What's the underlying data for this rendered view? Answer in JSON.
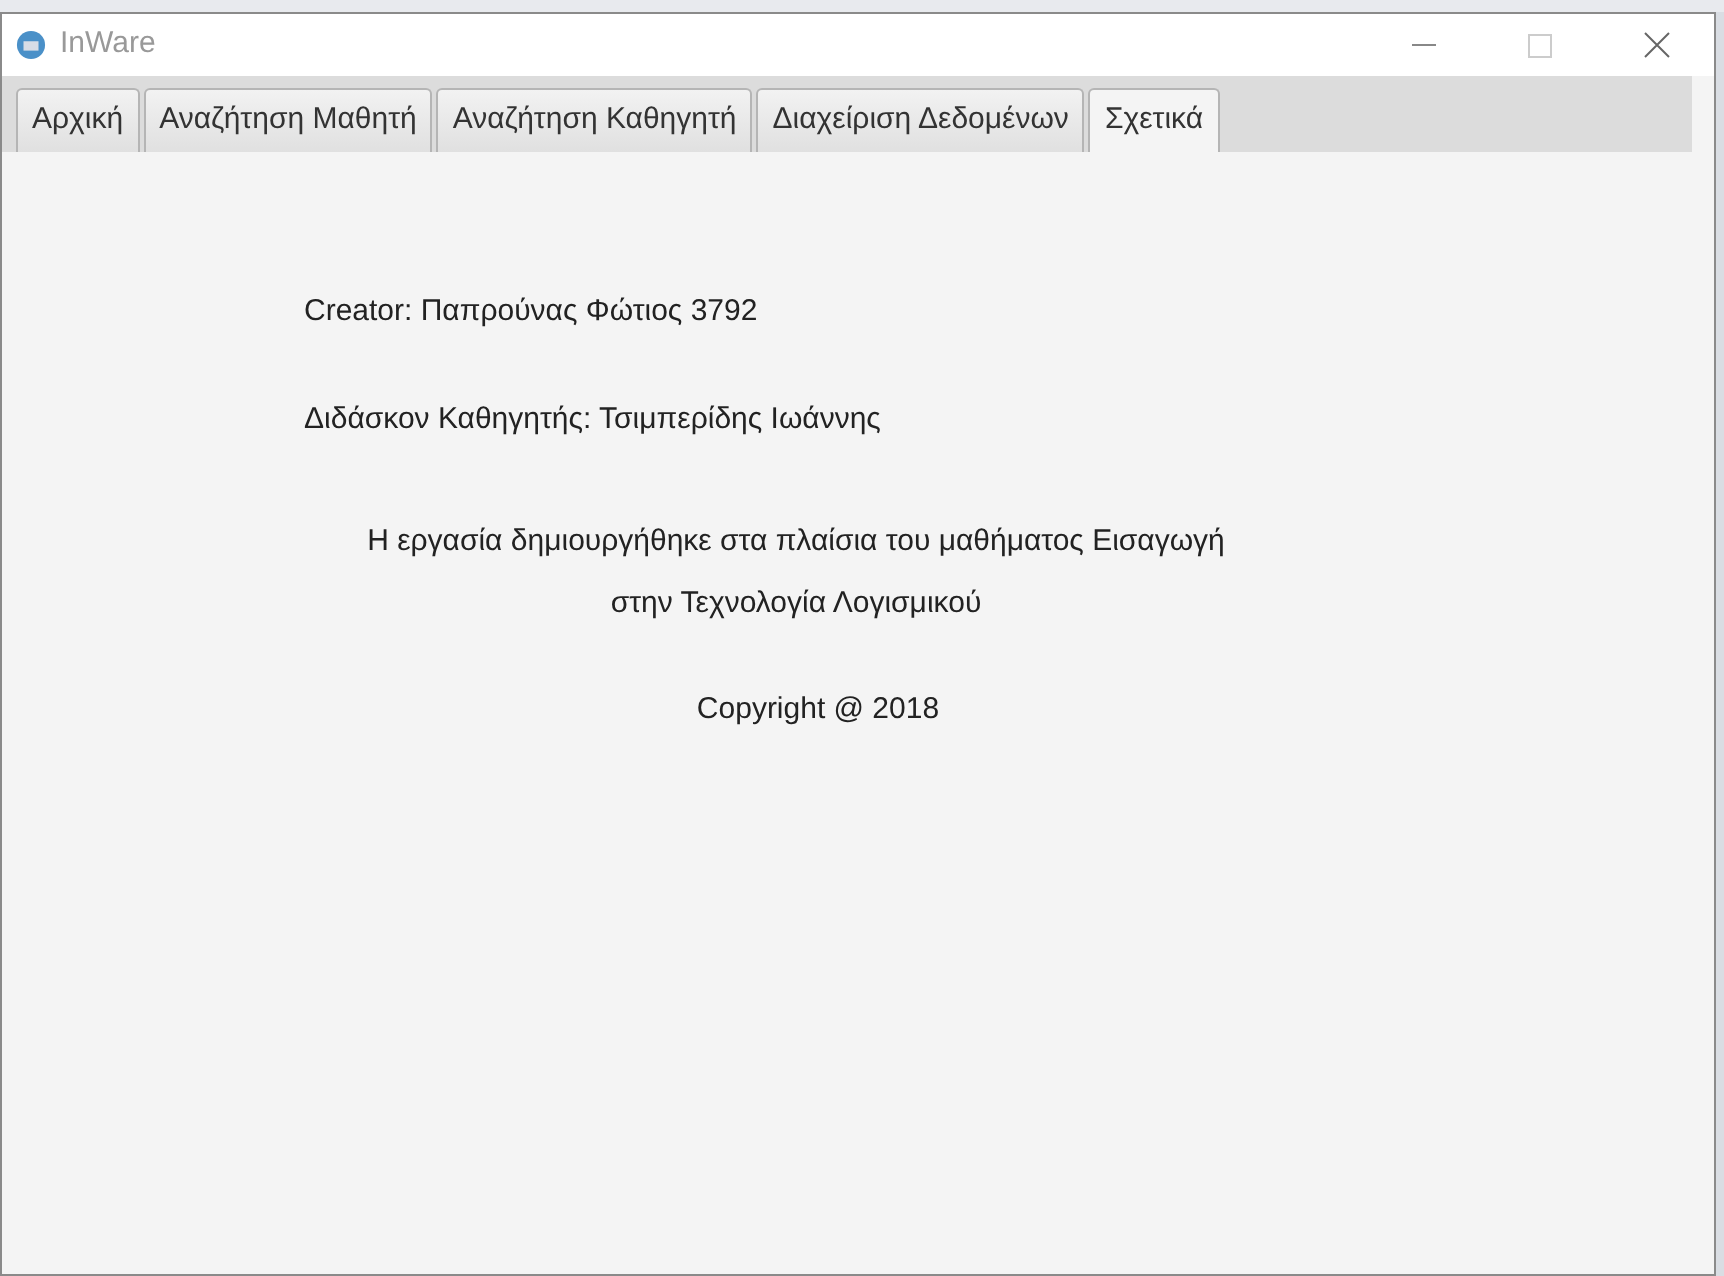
{
  "window": {
    "title": "InWare"
  },
  "tabs": [
    {
      "label": "Αρχική",
      "selected": false
    },
    {
      "label": "Αναζήτηση Μαθητή",
      "selected": false
    },
    {
      "label": "Αναζήτηση Καθηγητή",
      "selected": false
    },
    {
      "label": "Διαχείριση Δεδομένων",
      "selected": false
    },
    {
      "label": "Σχετικά",
      "selected": true
    }
  ],
  "about": {
    "creator": "Creator: Παπρούνας Φώτιος 3792",
    "teacher": "Διδάσκον Καθηγητής: Τσιμπερίδης Ιωάννης",
    "description": [
      "Η εργασία δημιουργήθηκε στα πλαίσια του μαθήματος Εισαγωγή",
      "στην Τεχνολογία Λογισμικού"
    ],
    "copyright": "Copyright @ 2018"
  }
}
